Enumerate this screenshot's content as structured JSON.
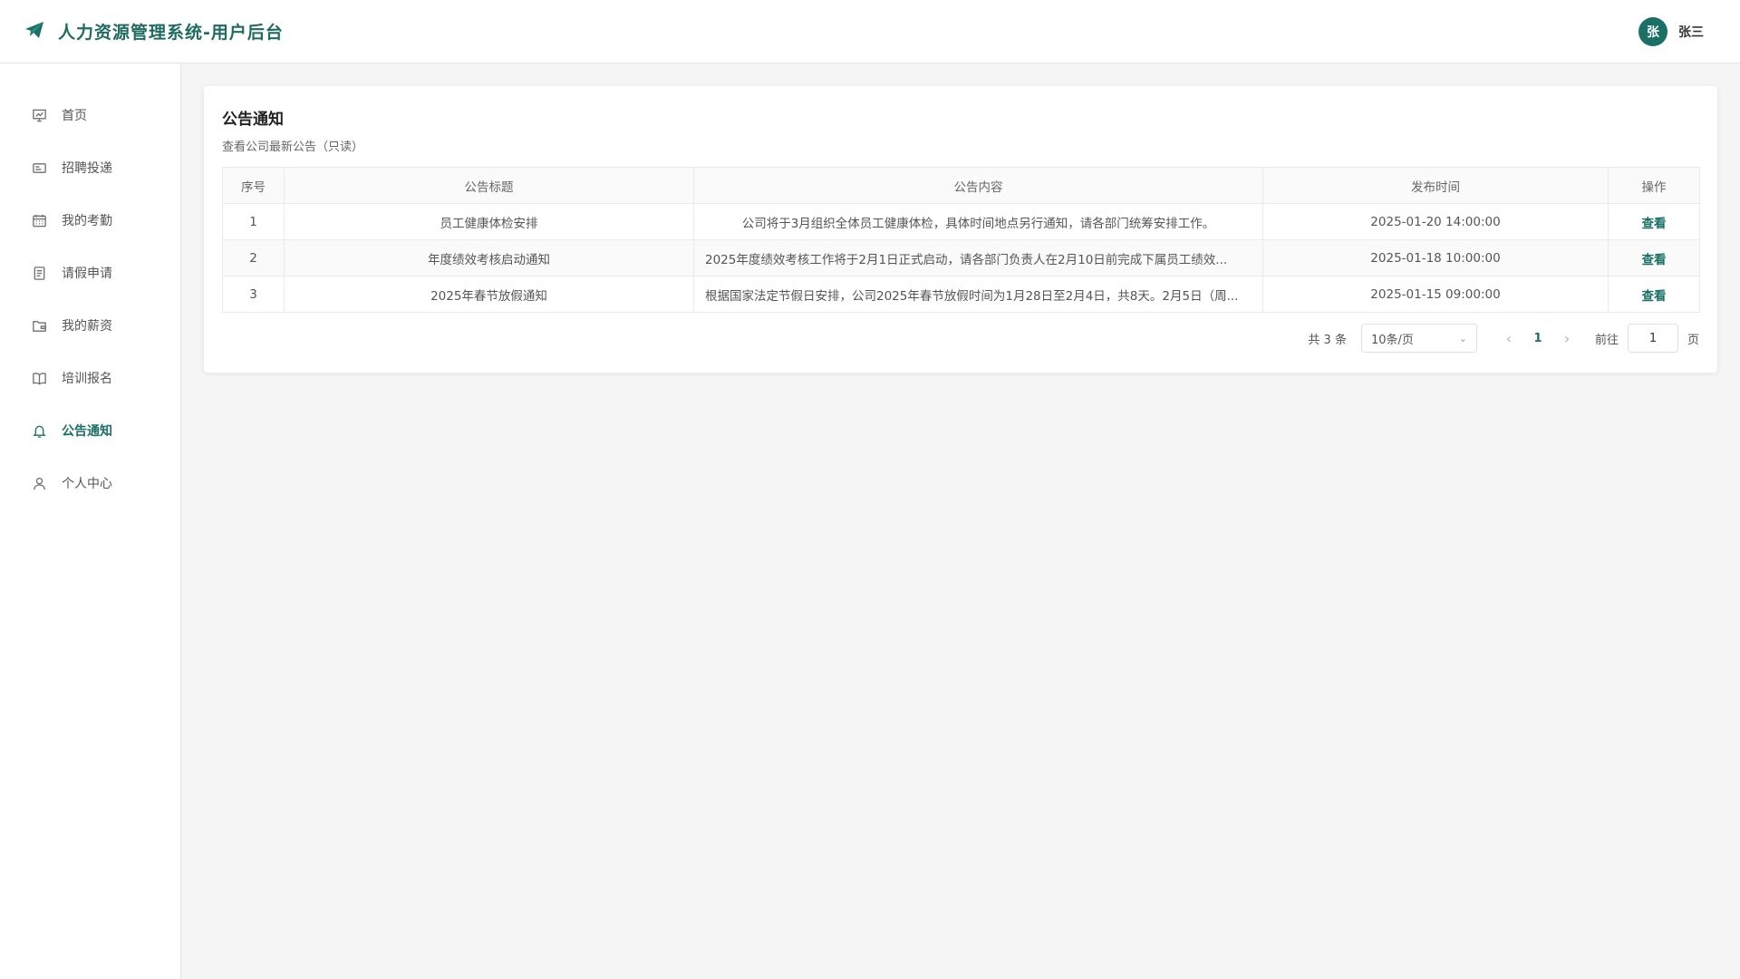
{
  "header": {
    "title": "人力资源管理系统-用户后台",
    "logo_icon": "paper-plane-icon",
    "user": {
      "avatar_text": "张",
      "name": "张三"
    }
  },
  "sidebar": {
    "items": [
      {
        "label": "首页",
        "icon": "presentation-icon",
        "active": false
      },
      {
        "label": "招聘投递",
        "icon": "id-card-icon",
        "active": false
      },
      {
        "label": "我的考勤",
        "icon": "calendar-icon",
        "active": false
      },
      {
        "label": "请假申请",
        "icon": "document-icon",
        "active": false
      },
      {
        "label": "我的薪资",
        "icon": "wallet-icon",
        "active": false
      },
      {
        "label": "培训报名",
        "icon": "book-icon",
        "active": false
      },
      {
        "label": "公告通知",
        "icon": "bell-icon",
        "active": true
      },
      {
        "label": "个人中心",
        "icon": "user-icon",
        "active": false
      }
    ]
  },
  "main": {
    "title": "公告通知",
    "subtitle": "查看公司最新公告（只读）",
    "table": {
      "columns": [
        "序号",
        "公告标题",
        "公告内容",
        "发布时间",
        "操作"
      ],
      "rows": [
        {
          "index": "1",
          "title": "员工健康体检安排",
          "content": "公司将于3月组织全体员工健康体检，具体时间地点另行通知，请各部门统筹安排工作。",
          "time": "2025-01-20 14:00:00",
          "action": "查看"
        },
        {
          "index": "2",
          "title": "年度绩效考核启动通知",
          "content": "2025年度绩效考核工作将于2月1日正式启动，请各部门负责人在2月10日前完成下属员工绩效...",
          "time": "2025-01-18 10:00:00",
          "action": "查看"
        },
        {
          "index": "3",
          "title": "2025年春节放假通知",
          "content": "根据国家法定节假日安排，公司2025年春节放假时间为1月28日至2月4日，共8天。2月5日（周...",
          "time": "2025-01-15 09:00:00",
          "action": "查看"
        }
      ]
    },
    "pagination": {
      "total_text": "共 3 条",
      "page_size": "10条/页",
      "current_page": "1",
      "goto_label": "前往",
      "goto_value": "1",
      "page_unit": "页"
    }
  },
  "colors": {
    "accent": "#1a7064",
    "background": "#f4f5f4"
  }
}
